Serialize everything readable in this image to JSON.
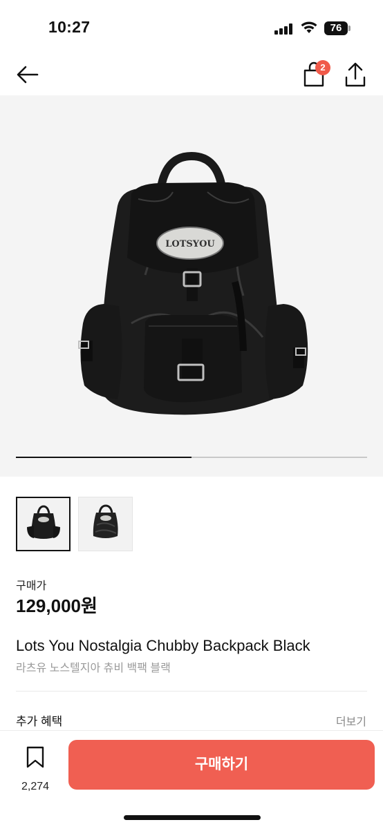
{
  "status_bar": {
    "time": "10:27",
    "battery": "76"
  },
  "nav": {
    "cart_count": "2"
  },
  "gallery": {
    "progress": 0.5,
    "thumbnail_count": 2,
    "active_index": 0
  },
  "product": {
    "price_label": "구매가",
    "price": "129,000원",
    "name_en": "Lots You Nostalgia Chubby Backpack Black",
    "name_ko": "라츠유 노스텔지아 츄비 백팩 블랙",
    "logo_text": "LOTSYOU"
  },
  "benefits": {
    "title": "추가 혜택",
    "more_label": "더보기"
  },
  "bottom_bar": {
    "wish_count": "2,274",
    "buy_label": "구매하기"
  },
  "colors": {
    "accent": "#f05f52",
    "badge": "#f05a4a",
    "background": "#f4f4f4"
  }
}
